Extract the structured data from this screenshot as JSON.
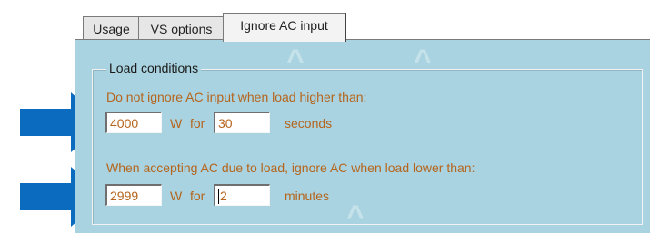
{
  "tabs": [
    {
      "label": "Usage"
    },
    {
      "label": "VS options"
    },
    {
      "label": "Ignore AC input"
    }
  ],
  "group": {
    "title": "Load conditions"
  },
  "row1": {
    "heading": "Do not ignore AC input when load higher than:",
    "load_value": "4000",
    "unit_w": "W",
    "for_label": "for",
    "time_value": "30",
    "time_unit": "seconds"
  },
  "row2": {
    "heading": "When accepting AC due to load, ignore AC when load lower than:",
    "load_value": "2999",
    "unit_w": "W",
    "for_label": "for",
    "time_value": "2",
    "time_unit": "minutes"
  },
  "colors": {
    "panel_bg": "#a9d3e0",
    "label_orange": "#b5651d",
    "arrow_blue": "#0b6cbf"
  }
}
